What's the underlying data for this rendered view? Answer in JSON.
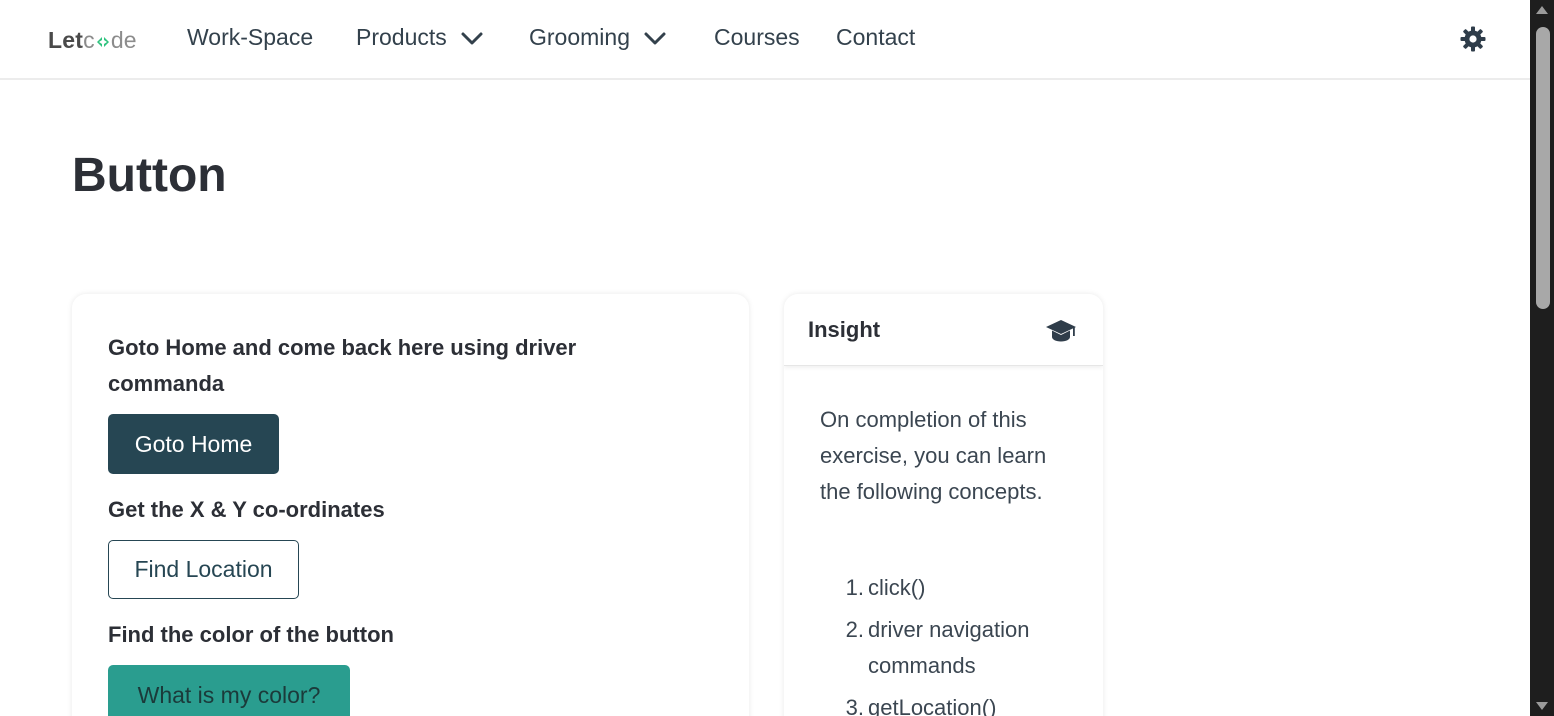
{
  "nav": {
    "logo": {
      "let": "Let",
      "co": "c",
      "de": "de"
    },
    "items": [
      {
        "label": "Work-Space"
      },
      {
        "label": "Products"
      },
      {
        "label": "Grooming"
      },
      {
        "label": "Courses"
      },
      {
        "label": "Contact"
      }
    ],
    "icons": {
      "dropdown": "chevron-down-icon",
      "theme": "gear-icon"
    }
  },
  "page": {
    "title": "Button"
  },
  "exercise": {
    "q1": "Goto Home and come back here using driver commanda",
    "btn_home": "Goto Home",
    "q2": "Get the X & Y co-ordinates",
    "btn_location": "Find Location",
    "q3": "Find the color of the button",
    "btn_color": "What is my color?"
  },
  "insight": {
    "title": "Insight",
    "icon": "graduation-cap-icon",
    "body": "On completion of this exercise, you can learn the following concepts.",
    "concepts": [
      {
        "num": "1.",
        "text": "click()"
      },
      {
        "num": "2.",
        "text": "driver navigation commands"
      },
      {
        "num": "3.",
        "text": "getLocation()"
      }
    ]
  },
  "colors": {
    "navy": "#264653",
    "teal": "#2a9d8f",
    "text": "#2c2f36",
    "logo_accent": "#2ec27e"
  }
}
